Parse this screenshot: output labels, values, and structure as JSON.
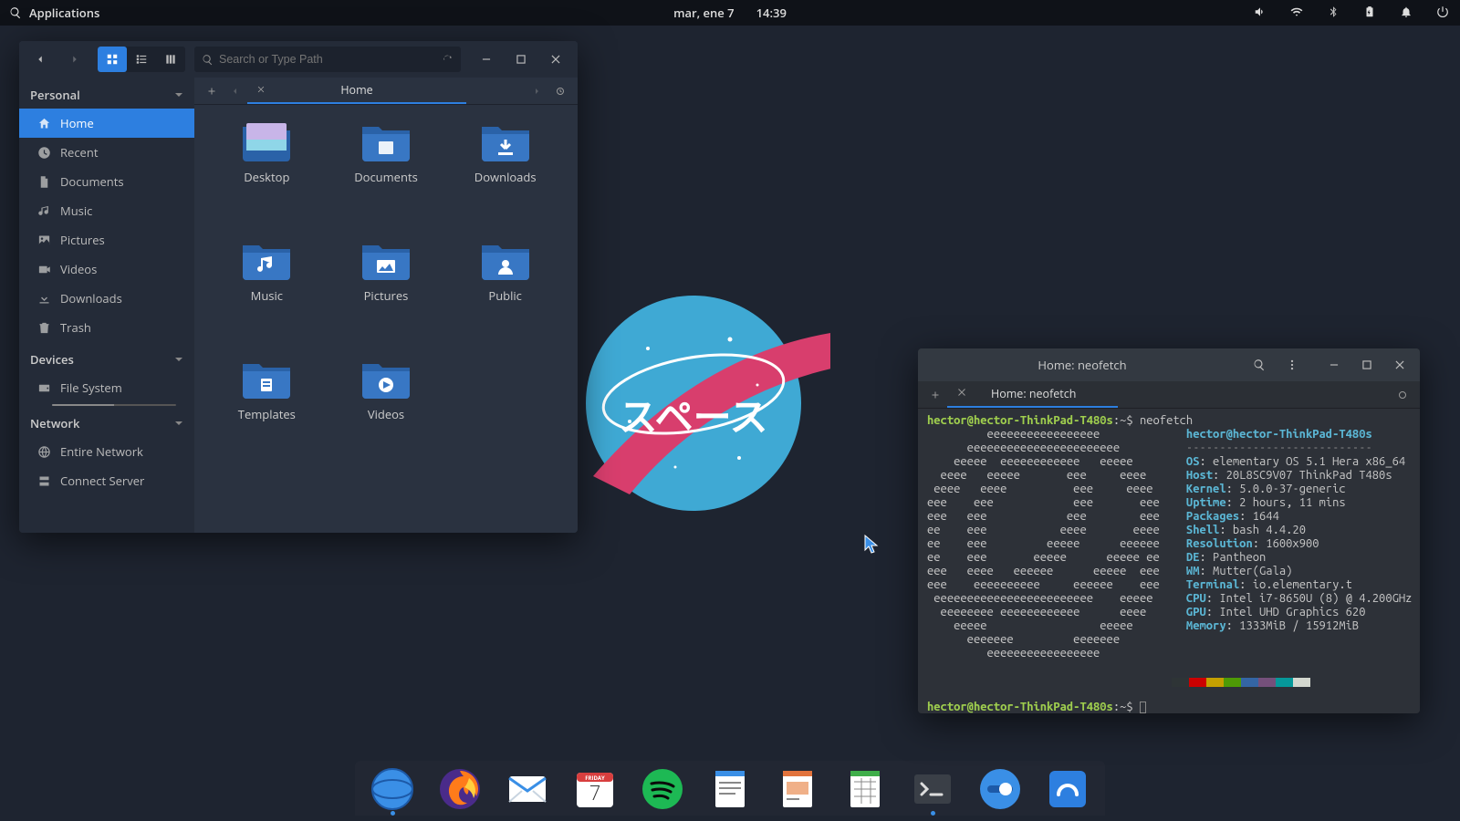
{
  "panel": {
    "applications": "Applications",
    "date": "mar, ene  7",
    "time": "14:39"
  },
  "files": {
    "search_placeholder": "Search or Type Path",
    "sidebar": {
      "section_personal": "Personal",
      "section_devices": "Devices",
      "section_network": "Network",
      "items": {
        "home": "Home",
        "recent": "Recent",
        "documents": "Documents",
        "music": "Music",
        "pictures": "Pictures",
        "videos": "Videos",
        "downloads": "Downloads",
        "trash": "Trash",
        "filesystem": "File System",
        "entire_network": "Entire Network",
        "connect_server": "Connect Server"
      }
    },
    "tab_label": "Home",
    "folders": {
      "desktop": "Desktop",
      "documents": "Documents",
      "downloads": "Downloads",
      "music": "Music",
      "pictures": "Pictures",
      "public": "Public",
      "templates": "Templates",
      "videos": "Videos"
    }
  },
  "terminal": {
    "title": "Home: neofetch",
    "tab_label": "Home: neofetch",
    "prompt_user": "hector@hector-ThinkPad-T480s",
    "prompt_path": ":~$ ",
    "command": "neofetch",
    "nf_user": "hector@hector-ThinkPad-T480s",
    "OS": "elementary OS 5.1 Hera x86_64",
    "Host": "20L8SC9V07 ThinkPad T480s",
    "Kernel": "5.0.0-37-generic",
    "Uptime": "2 hours, 11 mins",
    "Packages": "1644",
    "Shell": "bash 4.4.20",
    "Resolution": "1600x900",
    "DE": "Pantheon",
    "WM": "Mutter(Gala)",
    "Terminal": "io.elementary.t",
    "CPU": "Intel i7-8650U (8) @ 4.200GHz",
    "GPU": "Intel UHD Graphics 620",
    "Memory": "1333MiB / 15912MiB",
    "swatches": [
      "#2e3436",
      "#cc0000",
      "#c4a000",
      "#4e9a06",
      "#3465a4",
      "#75507b",
      "#06989a",
      "#d3d7cf"
    ]
  },
  "calendar_day": "7",
  "calendar_weekday": "FRIDAY"
}
